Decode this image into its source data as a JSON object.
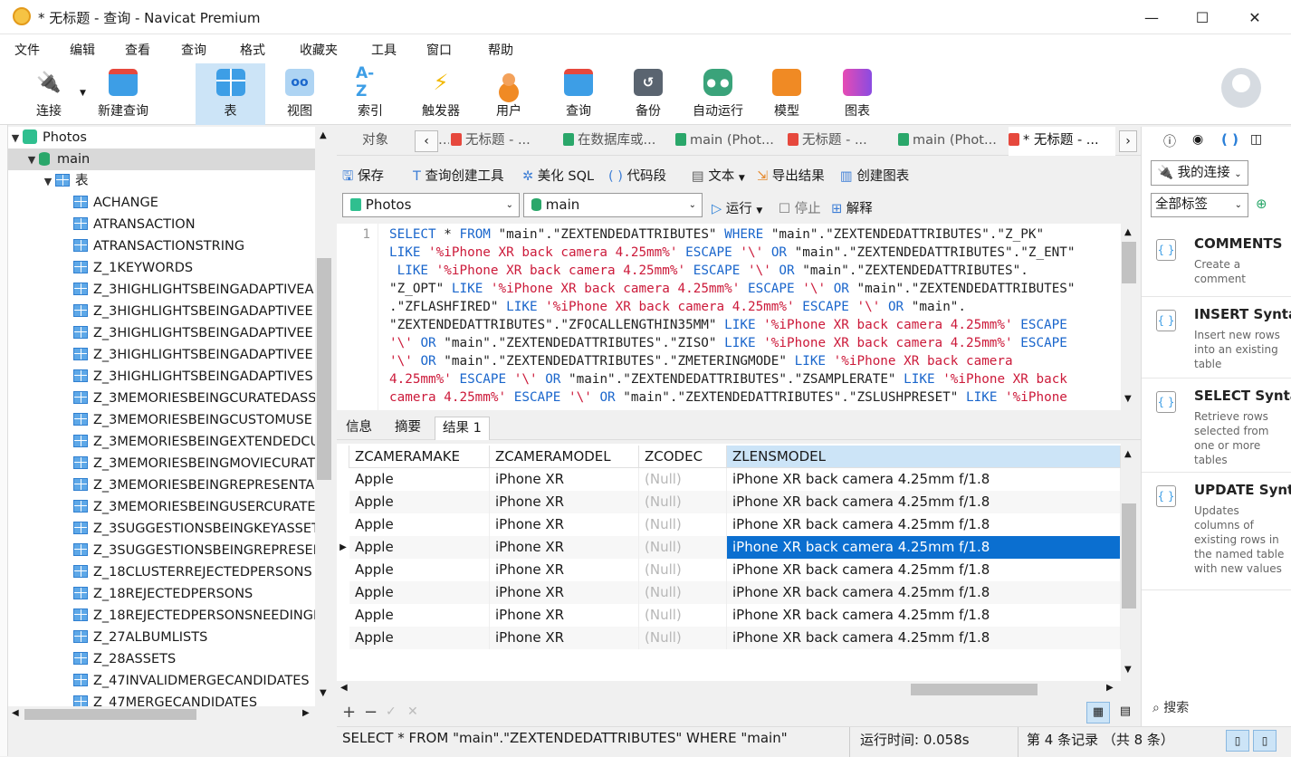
{
  "window": {
    "title": "* 无标题 - 查询 - Navicat Premium",
    "minimize": "—",
    "maximize": "☐",
    "close": "✕"
  },
  "menu": [
    "文件",
    "编辑",
    "查看",
    "查询",
    "格式",
    "收藏夹",
    "工具",
    "窗口",
    "帮助"
  ],
  "toolbar": [
    {
      "label": "连接",
      "icon": "plug-icon",
      "color": "#7a8c9c"
    },
    {
      "label": "新建查询",
      "icon": "new-query-icon",
      "color": "#3d9ee6"
    },
    {
      "label": "表",
      "icon": "table-icon",
      "color": "#3d9ee6"
    },
    {
      "label": "视图",
      "icon": "view-icon",
      "color": "#5aa9e6"
    },
    {
      "label": "索引",
      "icon": "index-icon",
      "color": "#3d9ee6",
      "glyph": "A-Z"
    },
    {
      "label": "触发器",
      "icon": "trigger-icon",
      "color": "#f2b800",
      "glyph": "⚡"
    },
    {
      "label": "用户",
      "icon": "user-icon",
      "color": "#f08a24"
    },
    {
      "label": "查询",
      "icon": "query-icon",
      "color": "#3d9ee6"
    },
    {
      "label": "备份",
      "icon": "backup-icon",
      "color": "#5a6470"
    },
    {
      "label": "自动运行",
      "icon": "robot-icon",
      "color": "#3aa37a"
    },
    {
      "label": "模型",
      "icon": "model-icon",
      "color": "#f08a24"
    },
    {
      "label": "图表",
      "icon": "chart-icon",
      "color": "#b44be1"
    }
  ],
  "tree": {
    "root": "Photos",
    "db": "main",
    "folder": "表",
    "tables": [
      "ACHANGE",
      "ATRANSACTION",
      "ATRANSACTIONSTRING",
      "Z_1KEYWORDS",
      "Z_3HIGHLIGHTSBEINGADAPTIVEA",
      "Z_3HIGHLIGHTSBEINGADAPTIVEE",
      "Z_3HIGHLIGHTSBEINGADAPTIVEE",
      "Z_3HIGHLIGHTSBEINGADAPTIVEE",
      "Z_3HIGHLIGHTSBEINGADAPTIVES",
      "Z_3MEMORIESBEINGCURATEDASS",
      "Z_3MEMORIESBEINGCUSTOMUSE",
      "Z_3MEMORIESBEINGEXTENDEDCU",
      "Z_3MEMORIESBEINGMOVIECURAT",
      "Z_3MEMORIESBEINGREPRESENTA",
      "Z_3MEMORIESBEINGUSERCURATE",
      "Z_3SUGGESTIONSBEINGKEYASSET",
      "Z_3SUGGESTIONSBEINGREPRESEN",
      "Z_18CLUSTERREJECTEDPERSONS",
      "Z_18REJECTEDPERSONS",
      "Z_18REJECTEDPERSONSNEEDINGF",
      "Z_27ALBUMLISTS",
      "Z_28ASSETS",
      "Z_47INVALIDMERGECANDIDATES",
      "Z_47MERGECANDIDATES"
    ]
  },
  "tabs": [
    "对象",
    "无标题 - ...",
    "在数据库或...",
    "main (Phot...",
    "无标题 - ...",
    "main (Phot...",
    "* 无标题 - ..."
  ],
  "editor_toolbar": {
    "save": "保存",
    "builder": "查询创建工具",
    "beautify": "美化 SQL",
    "snippet": "代码段",
    "text": "文本",
    "export": "导出结果",
    "create_chart": "创建图表"
  },
  "conn_select": "Photos",
  "db_select": "main",
  "run": "运行",
  "stop": "停止",
  "explain": "解释",
  "code": {
    "line_number": "1"
  },
  "result_tabs": [
    "信息",
    "摘要",
    "结果 1"
  ],
  "grid": {
    "columns": [
      "ZCAMERAMAKE",
      "ZCAMERAMODEL",
      "ZCODEC",
      "ZLENSMODEL"
    ],
    "rows": [
      [
        "Apple",
        "iPhone XR",
        "(Null)",
        "iPhone XR back camera 4.25mm f/1.8"
      ],
      [
        "Apple",
        "iPhone XR",
        "(Null)",
        "iPhone XR back camera 4.25mm f/1.8"
      ],
      [
        "Apple",
        "iPhone XR",
        "(Null)",
        "iPhone XR back camera 4.25mm f/1.8"
      ],
      [
        "Apple",
        "iPhone XR",
        "(Null)",
        "iPhone XR back camera 4.25mm f/1.8"
      ],
      [
        "Apple",
        "iPhone XR",
        "(Null)",
        "iPhone XR back camera 4.25mm f/1.8"
      ],
      [
        "Apple",
        "iPhone XR",
        "(Null)",
        "iPhone XR back camera 4.25mm f/1.8"
      ],
      [
        "Apple",
        "iPhone XR",
        "(Null)",
        "iPhone XR back camera 4.25mm f/1.8"
      ],
      [
        "Apple",
        "iPhone XR",
        "(Null)",
        "iPhone XR back camera 4.25mm f/1.8"
      ]
    ],
    "selected_row": 4
  },
  "status": {
    "sql": "SELECT * FROM \"main\".\"ZEXTENDEDATTRIBUTES\" WHERE \"main\"",
    "time": "运行时间: 0.058s",
    "record": "第 4 条记录 （共 8 条）"
  },
  "right": {
    "my_conn": "我的连接",
    "all_tags": "全部标签",
    "search": "搜索",
    "snippets": [
      {
        "title": "COMMENTS",
        "desc": "Create a comment"
      },
      {
        "title": "INSERT Synta",
        "desc": "Insert new rows into an existing table"
      },
      {
        "title": "SELECT Synta",
        "desc": "Retrieve rows selected from one or more tables"
      },
      {
        "title": "UPDATE Synt",
        "desc": "Updates columns of existing rows in the named table with new values"
      }
    ]
  },
  "colors": {
    "accent": "#0b6fd0",
    "selection": "#cce4f7",
    "keyword": "#1a66cc",
    "string": "#cc1a3a"
  }
}
